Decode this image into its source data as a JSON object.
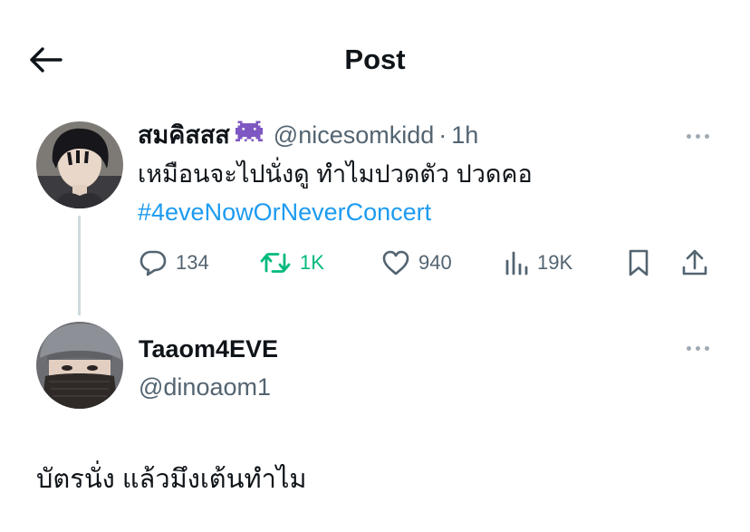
{
  "header": {
    "title": "Post",
    "back_icon": "arrow-left-icon"
  },
  "original_post": {
    "display_name": "สมคิสสส",
    "name_emoji": "alien-monster-icon",
    "handle": "@nicesomkidd",
    "separator": "·",
    "time": "1h",
    "text": "เหมือนจะไปนั่งดู ทำไมปวดตัว ปวดคอ",
    "hashtag": "#4eveNowOrNeverConcert",
    "stats": {
      "replies": "134",
      "reposts": "1K",
      "likes": "940",
      "views": "19K"
    }
  },
  "reply": {
    "display_name": "Taaom4EVE",
    "handle": "@dinoaom1",
    "text": "บัตรนั่ง แล้วมึงเต้นทำไม"
  },
  "colors": {
    "accent": "#1d9bf0",
    "repost": "#00ba7c",
    "muted": "#536471",
    "emoji": "#7e57c2"
  }
}
